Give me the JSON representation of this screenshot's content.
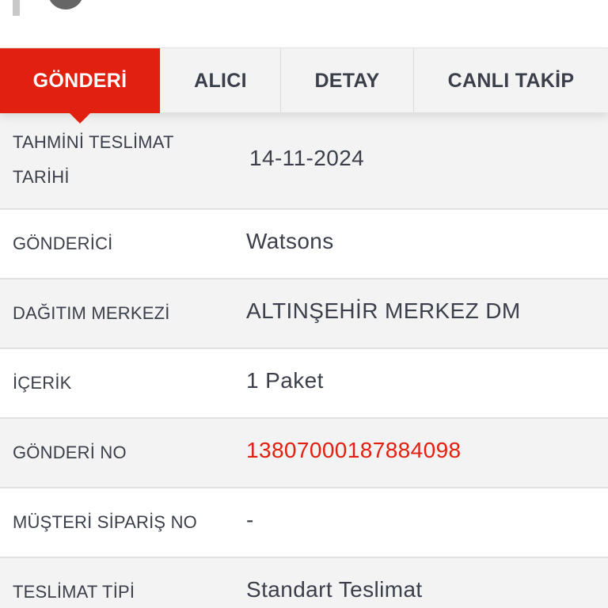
{
  "tabs": [
    {
      "label": "GÖNDERİ",
      "active": true
    },
    {
      "label": "ALICI",
      "active": false
    },
    {
      "label": "DETAY",
      "active": false
    },
    {
      "label": "CANLI TAKİP",
      "active": false
    }
  ],
  "details": {
    "estimated_delivery": {
      "label": "TAHMİNİ TESLİMAT TARİHİ",
      "value": "14-11-2024"
    },
    "sender": {
      "label": "GÖNDERİCİ",
      "value": "Watsons"
    },
    "distribution_center": {
      "label": "DAĞITIM MERKEZİ",
      "value": "ALTINŞEHİR MERKEZ DM"
    },
    "content": {
      "label": "İÇERİK",
      "value": "1 Paket"
    },
    "shipment_no": {
      "label": "GÖNDERİ NO",
      "value": "13807000187884098"
    },
    "customer_order_no": {
      "label": "MÜŞTERİ SİPARİŞ NO",
      "value": "-"
    },
    "delivery_type": {
      "label": "TESLİMAT TİPİ",
      "value": "Standart Teslimat"
    }
  },
  "colors": {
    "accent": "#e2200f",
    "text": "#3b3f4a",
    "row_gray": "#f3f3f3",
    "row_white": "#ffffff",
    "divider": "#e2e2e2"
  }
}
